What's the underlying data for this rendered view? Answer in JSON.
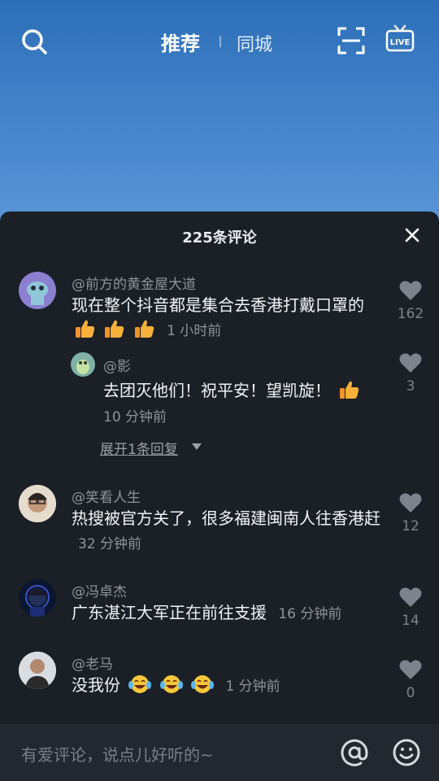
{
  "header": {
    "tab_recommend": "推荐",
    "tab_local": "同城",
    "live_label": "LIVE"
  },
  "sheet": {
    "title": "225条评论"
  },
  "comments": [
    {
      "username": "@前方的黄金屋大道",
      "text": "现在整个抖音都是集合去香港打戴口罩的",
      "time": "1 小时前",
      "likes": "162",
      "reply": {
        "username": "@影",
        "text": "去团灭他们！祝平安！望凯旋！",
        "time": "10 分钟前",
        "likes": "3"
      },
      "expand": "展开1条回复"
    },
    {
      "username": "@笑看人生",
      "text": "热搜被官方关了，很多福建闽南人往香港赶",
      "time": "32 分钟前",
      "likes": "12"
    },
    {
      "username": "@冯卓杰",
      "text": "广东湛江大军正在前往支援",
      "time": "16 分钟前",
      "likes": "14"
    },
    {
      "username": "@老马",
      "text": "没我份",
      "time": "1 分钟前",
      "likes": "0"
    }
  ],
  "input": {
    "placeholder": "有爱评论，说点儿好听的~"
  },
  "icons": {
    "search": "search-icon",
    "scan": "scan-icon",
    "live": "live-tv-icon",
    "close": "close-icon",
    "like": "heart-icon",
    "thumbs": "thumbs-up-emoji",
    "laugh": "laugh-cry-emoji",
    "mention": "at-icon",
    "emoji": "smiley-icon"
  }
}
